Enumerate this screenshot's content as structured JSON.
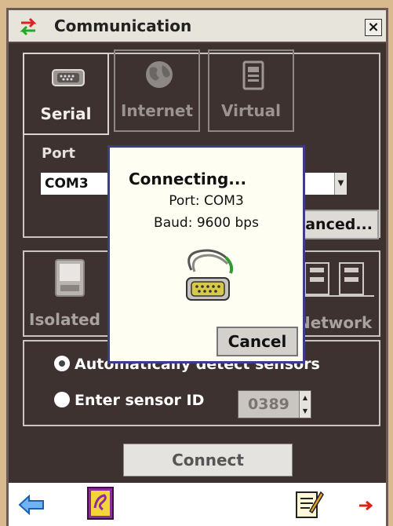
{
  "window": {
    "title": "Communication",
    "close_label": "×"
  },
  "tabs": [
    {
      "label": "Serial",
      "icon": "serial-port-icon",
      "active": true
    },
    {
      "label": "Internet",
      "icon": "globe-icon",
      "active": false
    },
    {
      "label": "Virtual",
      "icon": "virtual-device-icon",
      "active": false
    }
  ],
  "port": {
    "label": "Port",
    "value": "COM3"
  },
  "advanced_label": "anced...",
  "mode_tabs": {
    "isolated_label": "Isolated",
    "network_label": "Network"
  },
  "sensors": {
    "auto_label": "Automatically detect sensors",
    "auto_checked": true,
    "enter_label": "Enter sensor ID",
    "sensor_id": "0389"
  },
  "connect_label": "Connect",
  "dialog": {
    "title": "Connecting...",
    "port_line": "Port: COM3",
    "baud_line": "Baud: 9600 bps",
    "cancel_label": "Cancel"
  },
  "toolbar": {
    "back_icon": "back-arrow-icon",
    "help_icon": "help-book-icon",
    "notes_icon": "notepad-icon",
    "next_icon": "forward-arrow-icon"
  },
  "colors": {
    "window_bg": "#3e3230",
    "dialog_border": "#3c3c8c",
    "dialog_bg": "#fffef2"
  }
}
